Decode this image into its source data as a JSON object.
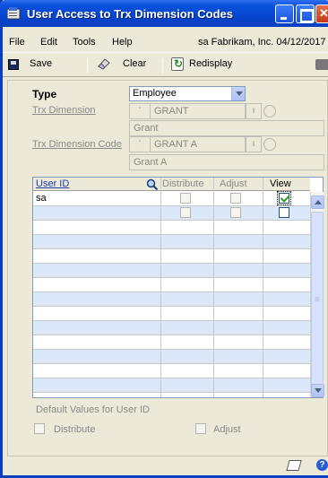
{
  "window": {
    "title": "User Access to Trx Dimension Codes"
  },
  "menu": {
    "items": [
      "File",
      "Edit",
      "Tools",
      "Help"
    ],
    "status": "sa  Fabrikam, Inc.  04/12/2017"
  },
  "toolbar": {
    "save_label": "Save",
    "clear_label": "Clear",
    "redisplay_label": "Redisplay"
  },
  "form": {
    "type_label": "Type",
    "type_value": "Employee",
    "trx_dimension_label": "Trx Dimension",
    "trx_dimension_value": "GRANT",
    "trx_dimension_desc": "Grant",
    "trx_dimension_code_label": "Trx Dimension Code",
    "trx_dimension_code_value": "GRANT A",
    "trx_dimension_code_desc": "Grant A"
  },
  "grid": {
    "columns": {
      "user_id": "User ID",
      "distribute": "Distribute",
      "adjust": "Adjust",
      "view": "View"
    },
    "rows": [
      {
        "user_id": "sa",
        "distribute": false,
        "adjust": false,
        "view": true
      },
      {
        "user_id": "",
        "distribute": false,
        "adjust": false,
        "view": false
      }
    ]
  },
  "defaults": {
    "label": "Default Values for User ID",
    "distribute_label": "Distribute",
    "adjust_label": "Adjust"
  }
}
